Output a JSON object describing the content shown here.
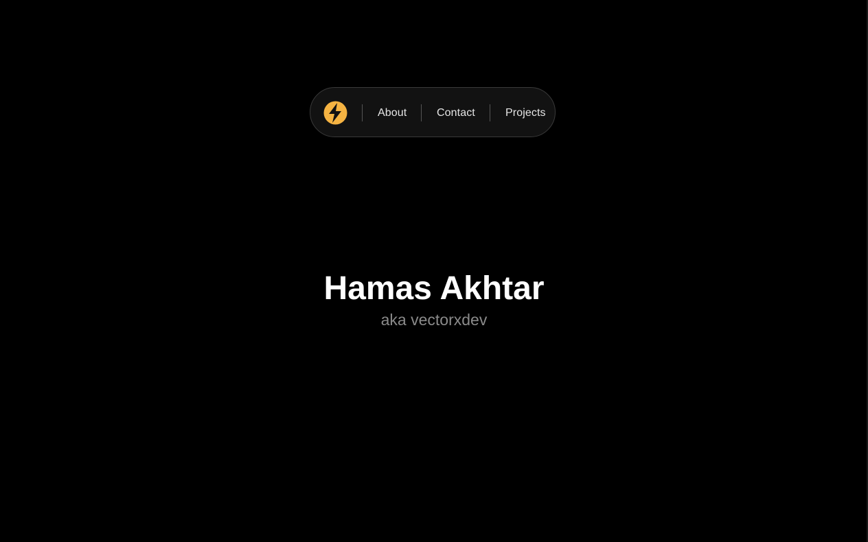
{
  "nav": {
    "logo_icon": "lightning-bolt-icon",
    "logo_color": "#F5B342",
    "links": [
      {
        "label": "About"
      },
      {
        "label": "Contact"
      },
      {
        "label": "Projects"
      }
    ]
  },
  "hero": {
    "title": "Hamas Akhtar",
    "subtitle": "aka vectorxdev"
  },
  "colors": {
    "background": "#000000",
    "nav_background": "#121212",
    "accent": "#F5B342",
    "title": "#FFFFFF",
    "subtitle": "#8A8A8A"
  }
}
